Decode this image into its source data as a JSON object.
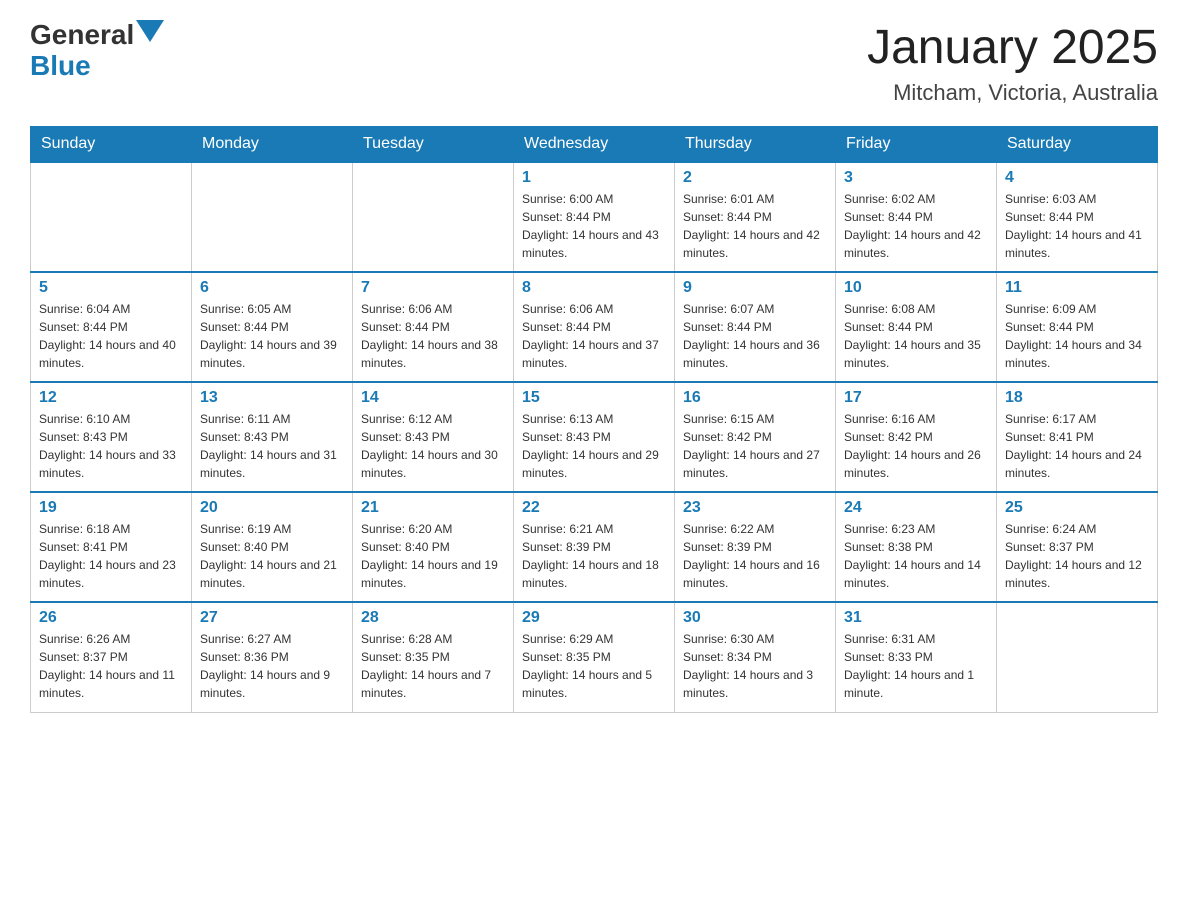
{
  "header": {
    "logo_general": "General",
    "logo_blue": "Blue",
    "title": "January 2025",
    "subtitle": "Mitcham, Victoria, Australia"
  },
  "days_of_week": [
    "Sunday",
    "Monday",
    "Tuesday",
    "Wednesday",
    "Thursday",
    "Friday",
    "Saturday"
  ],
  "weeks": [
    [
      {
        "day": "",
        "info": ""
      },
      {
        "day": "",
        "info": ""
      },
      {
        "day": "",
        "info": ""
      },
      {
        "day": "1",
        "info": "Sunrise: 6:00 AM\nSunset: 8:44 PM\nDaylight: 14 hours and 43 minutes."
      },
      {
        "day": "2",
        "info": "Sunrise: 6:01 AM\nSunset: 8:44 PM\nDaylight: 14 hours and 42 minutes."
      },
      {
        "day": "3",
        "info": "Sunrise: 6:02 AM\nSunset: 8:44 PM\nDaylight: 14 hours and 42 minutes."
      },
      {
        "day": "4",
        "info": "Sunrise: 6:03 AM\nSunset: 8:44 PM\nDaylight: 14 hours and 41 minutes."
      }
    ],
    [
      {
        "day": "5",
        "info": "Sunrise: 6:04 AM\nSunset: 8:44 PM\nDaylight: 14 hours and 40 minutes."
      },
      {
        "day": "6",
        "info": "Sunrise: 6:05 AM\nSunset: 8:44 PM\nDaylight: 14 hours and 39 minutes."
      },
      {
        "day": "7",
        "info": "Sunrise: 6:06 AM\nSunset: 8:44 PM\nDaylight: 14 hours and 38 minutes."
      },
      {
        "day": "8",
        "info": "Sunrise: 6:06 AM\nSunset: 8:44 PM\nDaylight: 14 hours and 37 minutes."
      },
      {
        "day": "9",
        "info": "Sunrise: 6:07 AM\nSunset: 8:44 PM\nDaylight: 14 hours and 36 minutes."
      },
      {
        "day": "10",
        "info": "Sunrise: 6:08 AM\nSunset: 8:44 PM\nDaylight: 14 hours and 35 minutes."
      },
      {
        "day": "11",
        "info": "Sunrise: 6:09 AM\nSunset: 8:44 PM\nDaylight: 14 hours and 34 minutes."
      }
    ],
    [
      {
        "day": "12",
        "info": "Sunrise: 6:10 AM\nSunset: 8:43 PM\nDaylight: 14 hours and 33 minutes."
      },
      {
        "day": "13",
        "info": "Sunrise: 6:11 AM\nSunset: 8:43 PM\nDaylight: 14 hours and 31 minutes."
      },
      {
        "day": "14",
        "info": "Sunrise: 6:12 AM\nSunset: 8:43 PM\nDaylight: 14 hours and 30 minutes."
      },
      {
        "day": "15",
        "info": "Sunrise: 6:13 AM\nSunset: 8:43 PM\nDaylight: 14 hours and 29 minutes."
      },
      {
        "day": "16",
        "info": "Sunrise: 6:15 AM\nSunset: 8:42 PM\nDaylight: 14 hours and 27 minutes."
      },
      {
        "day": "17",
        "info": "Sunrise: 6:16 AM\nSunset: 8:42 PM\nDaylight: 14 hours and 26 minutes."
      },
      {
        "day": "18",
        "info": "Sunrise: 6:17 AM\nSunset: 8:41 PM\nDaylight: 14 hours and 24 minutes."
      }
    ],
    [
      {
        "day": "19",
        "info": "Sunrise: 6:18 AM\nSunset: 8:41 PM\nDaylight: 14 hours and 23 minutes."
      },
      {
        "day": "20",
        "info": "Sunrise: 6:19 AM\nSunset: 8:40 PM\nDaylight: 14 hours and 21 minutes."
      },
      {
        "day": "21",
        "info": "Sunrise: 6:20 AM\nSunset: 8:40 PM\nDaylight: 14 hours and 19 minutes."
      },
      {
        "day": "22",
        "info": "Sunrise: 6:21 AM\nSunset: 8:39 PM\nDaylight: 14 hours and 18 minutes."
      },
      {
        "day": "23",
        "info": "Sunrise: 6:22 AM\nSunset: 8:39 PM\nDaylight: 14 hours and 16 minutes."
      },
      {
        "day": "24",
        "info": "Sunrise: 6:23 AM\nSunset: 8:38 PM\nDaylight: 14 hours and 14 minutes."
      },
      {
        "day": "25",
        "info": "Sunrise: 6:24 AM\nSunset: 8:37 PM\nDaylight: 14 hours and 12 minutes."
      }
    ],
    [
      {
        "day": "26",
        "info": "Sunrise: 6:26 AM\nSunset: 8:37 PM\nDaylight: 14 hours and 11 minutes."
      },
      {
        "day": "27",
        "info": "Sunrise: 6:27 AM\nSunset: 8:36 PM\nDaylight: 14 hours and 9 minutes."
      },
      {
        "day": "28",
        "info": "Sunrise: 6:28 AM\nSunset: 8:35 PM\nDaylight: 14 hours and 7 minutes."
      },
      {
        "day": "29",
        "info": "Sunrise: 6:29 AM\nSunset: 8:35 PM\nDaylight: 14 hours and 5 minutes."
      },
      {
        "day": "30",
        "info": "Sunrise: 6:30 AM\nSunset: 8:34 PM\nDaylight: 14 hours and 3 minutes."
      },
      {
        "day": "31",
        "info": "Sunrise: 6:31 AM\nSunset: 8:33 PM\nDaylight: 14 hours and 1 minute."
      },
      {
        "day": "",
        "info": ""
      }
    ]
  ]
}
